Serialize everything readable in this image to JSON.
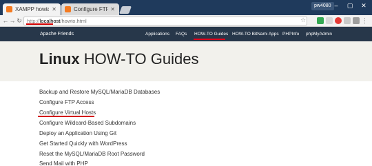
{
  "browser": {
    "tabs": [
      {
        "title": "XAMPP howto guides",
        "active": true
      },
      {
        "title": "Configure FTP Access",
        "active": false
      }
    ],
    "profile": "pw4080",
    "window_controls": {
      "minimize": "–",
      "maximize": "▢",
      "close": "✕"
    },
    "address": {
      "scheme": "http://",
      "host": "localhost",
      "path": "/howto.html"
    }
  },
  "site": {
    "brand": "Apache Friends",
    "nav": [
      {
        "label": "Applications",
        "active": false
      },
      {
        "label": "FAQs",
        "active": false
      },
      {
        "label": "HOW-TO Guides",
        "active": true
      },
      {
        "label": "HOW-TO BitNami Apps",
        "active": false
      },
      {
        "label": "PHPInfo",
        "active": false
      },
      {
        "label": "phpMyAdmin",
        "active": false
      }
    ]
  },
  "page": {
    "title_bold": "Linux",
    "title_rest": "HOW-TO Guides",
    "guides": [
      "Backup and Restore MySQL/MariaDB Databases",
      "Configure FTP Access",
      "Configure Virtual Hosts",
      "Configure Wildcard-Based Subdomains",
      "Deploy an Application Using Git",
      "Get Started Quickly with WordPress",
      "Reset the MySQL/MariaDB Root Password",
      "Send Mail with PHP"
    ]
  },
  "colors": {
    "tabstrip": "#1f3a5c",
    "site_header": "#27374a",
    "hero": "#f2f1ec",
    "highlight": "#d40000"
  }
}
